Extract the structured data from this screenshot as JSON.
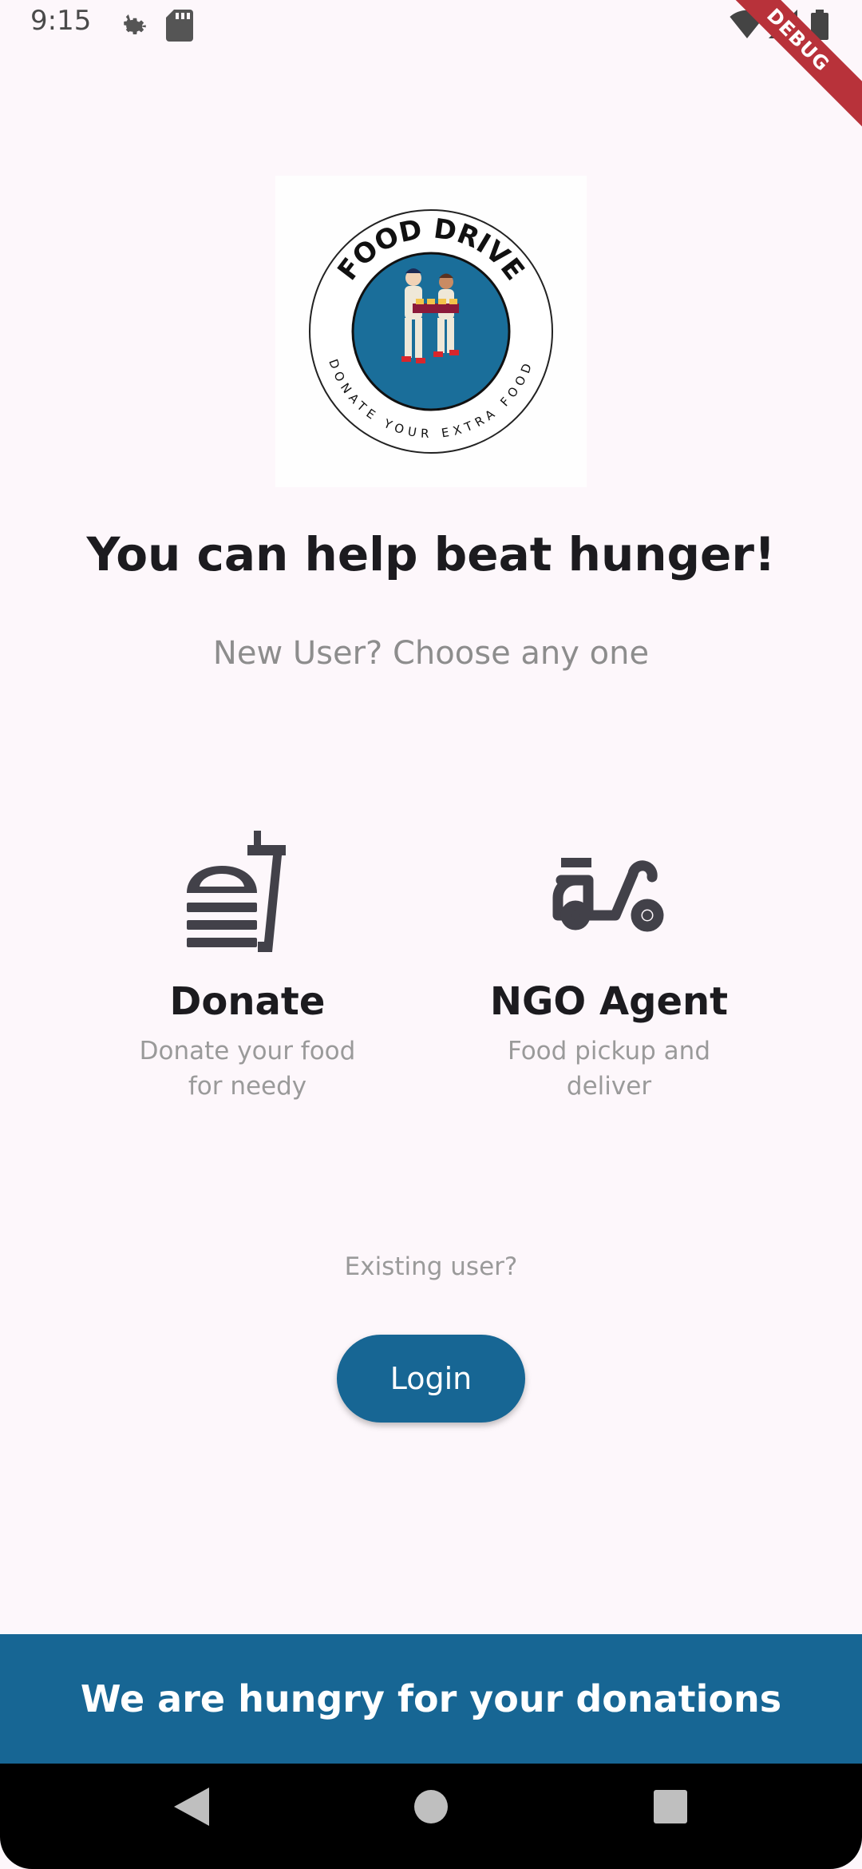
{
  "status_bar": {
    "time": "9:15",
    "icons": [
      "settings-icon",
      "sd-card-icon",
      "wifi-icon",
      "signal-icon",
      "battery-icon"
    ]
  },
  "debug_banner": "DEBUG",
  "logo": {
    "top_text": "FOOD DRIVE",
    "bottom_text": "DONATE YOUR EXTRA FOOD",
    "colors": {
      "circle": "#1a6e9a",
      "ring": "#222222"
    }
  },
  "headline": "You can help beat hunger!",
  "subheadline": "New User? Choose any one",
  "roles": [
    {
      "icon": "fastfood-icon",
      "title": "Donate",
      "description": "Donate your food for needy"
    },
    {
      "icon": "moped-icon",
      "title": "NGO Agent",
      "description": "Food pickup and deliver"
    }
  ],
  "existing_user": {
    "label": "Existing user?",
    "button": "Login"
  },
  "footer_banner": "We are hungry for your donations",
  "nav": [
    "back-icon",
    "home-icon",
    "recents-icon"
  ],
  "colors": {
    "primary": "#176694",
    "background": "#fdf7fb",
    "text": "#1c1b1f",
    "muted": "#9a9a9a"
  }
}
